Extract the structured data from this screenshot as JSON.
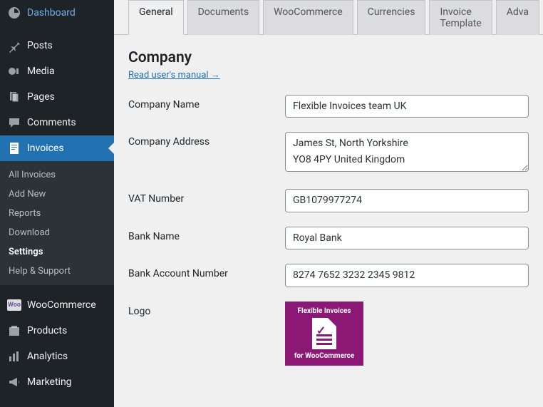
{
  "sidebar": {
    "items": [
      {
        "label": "Dashboard",
        "icon": "dashboard"
      },
      {
        "label": "Posts",
        "icon": "pin"
      },
      {
        "label": "Media",
        "icon": "media"
      },
      {
        "label": "Pages",
        "icon": "pages"
      },
      {
        "label": "Comments",
        "icon": "comments"
      },
      {
        "label": "Invoices",
        "icon": "invoices",
        "current": true
      },
      {
        "label": "WooCommerce",
        "icon": "woo"
      },
      {
        "label": "Products",
        "icon": "products"
      },
      {
        "label": "Analytics",
        "icon": "analytics"
      },
      {
        "label": "Marketing",
        "icon": "marketing"
      }
    ],
    "submenu": [
      {
        "label": "All Invoices"
      },
      {
        "label": "Add New"
      },
      {
        "label": "Reports"
      },
      {
        "label": "Download"
      },
      {
        "label": "Settings",
        "current": true
      },
      {
        "label": "Help & Support"
      }
    ]
  },
  "tabs": [
    {
      "label": "General",
      "active": true
    },
    {
      "label": "Documents"
    },
    {
      "label": "WooCommerce"
    },
    {
      "label": "Currencies"
    },
    {
      "label": "Invoice Template"
    },
    {
      "label": "Adva"
    }
  ],
  "section": {
    "title": "Company",
    "manual_link": "Read user's manual →"
  },
  "form": {
    "company_name": {
      "label": "Company Name",
      "value": "Flexible Invoices team UK"
    },
    "company_address": {
      "label": "Company Address",
      "value": "James St, North Yorkshire\nYO8 4PY United Kingdom"
    },
    "vat_number": {
      "label": "VAT Number",
      "value": "GB1079977274"
    },
    "bank_name": {
      "label": "Bank Name",
      "value": "Royal Bank"
    },
    "bank_account": {
      "label": "Bank Account Number",
      "value": "8274 7652 3232 2345 9812"
    },
    "logo": {
      "label": "Logo",
      "text_top": "Flexible Invoices",
      "text_bottom": "for WooCommerce"
    }
  }
}
